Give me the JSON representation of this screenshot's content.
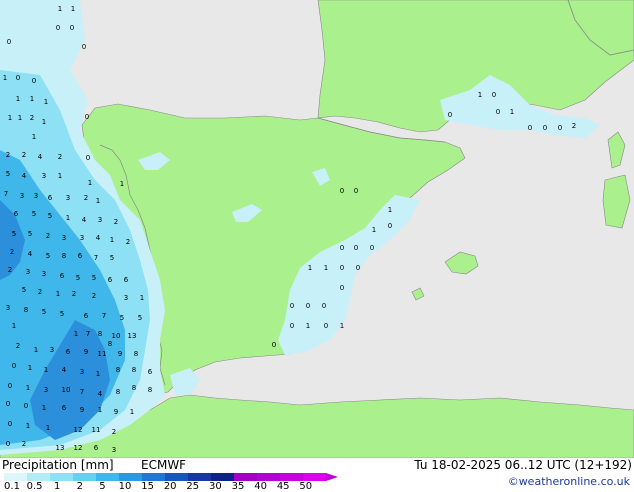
{
  "legend": {
    "title": "Precipitation [mm]",
    "model": "ECMWF",
    "ticks": [
      "0.1",
      "0.5",
      "1",
      "2",
      "5",
      "10",
      "15",
      "20",
      "25",
      "30",
      "35",
      "40",
      "45",
      "50"
    ],
    "colors": [
      "#ddf6fb",
      "#b2ecf7",
      "#8ee0f4",
      "#66d0ef",
      "#3fb7ea",
      "#2c98de",
      "#2277d2",
      "#1a55bb",
      "#1638a0",
      "#102282",
      "#a000c8",
      "#b400d4",
      "#c800e0",
      "#dc00ec"
    ]
  },
  "valid_time": "Tu 18-02-2025 06..12 UTC (12+192)",
  "copyright": "©weatheronline.co.uk",
  "map": {
    "colors": {
      "sea": "#e8e8e8",
      "land": "#aaf08c",
      "border": "#808080",
      "light_precip": "#c8f0f8",
      "medium_precip": "#8ee0f4",
      "heavy_precip": "#3fb7ea",
      "very_heavy_precip": "#2c8fdc"
    },
    "values": [
      "1",
      "1",
      "0",
      "0",
      "0",
      "0",
      "1",
      "0",
      "0",
      "1",
      "1",
      "1",
      "0",
      "1",
      "1",
      "2",
      "1",
      "1",
      "2",
      "2",
      "4",
      "2",
      "5",
      "4",
      "3",
      "1",
      "7",
      "3",
      "3",
      "6",
      "3",
      "2",
      "1",
      "6",
      "5",
      "5",
      "1",
      "4",
      "3",
      "2",
      "5",
      "5",
      "2",
      "3",
      "3",
      "4",
      "1",
      "2",
      "2",
      "4",
      "5",
      "8",
      "6",
      "7",
      "5",
      "2",
      "3",
      "3",
      "6",
      "5",
      "5",
      "6",
      "6",
      "5",
      "2",
      "1",
      "2",
      "2",
      "3",
      "1",
      "3",
      "8",
      "5",
      "5",
      "6",
      "7",
      "5",
      "5",
      "1",
      "1",
      "7",
      "8",
      "10",
      "13",
      "9",
      "8",
      "8",
      "2",
      "1",
      "3",
      "6",
      "9",
      "11",
      "8",
      "8",
      "6",
      "0",
      "1",
      "1",
      "4",
      "3",
      "1",
      "8",
      "8",
      "8",
      "0",
      "1",
      "3",
      "10",
      "7",
      "4",
      "0",
      "0",
      "1",
      "6",
      "9",
      "1",
      "9",
      "1",
      "0",
      "1",
      "1",
      "12",
      "11",
      "2",
      "0",
      "2",
      "13",
      "12",
      "6",
      "3",
      "1",
      "1",
      "0",
      "0",
      "0",
      "0",
      "0",
      "0",
      "0",
      "1",
      "1",
      "1",
      "1",
      "0",
      "0",
      "0",
      "0",
      "0",
      "0",
      "0",
      "1",
      "0",
      "1",
      "0",
      "1",
      "0",
      "0",
      "0",
      "1",
      "0",
      "0",
      "0",
      "2"
    ]
  }
}
